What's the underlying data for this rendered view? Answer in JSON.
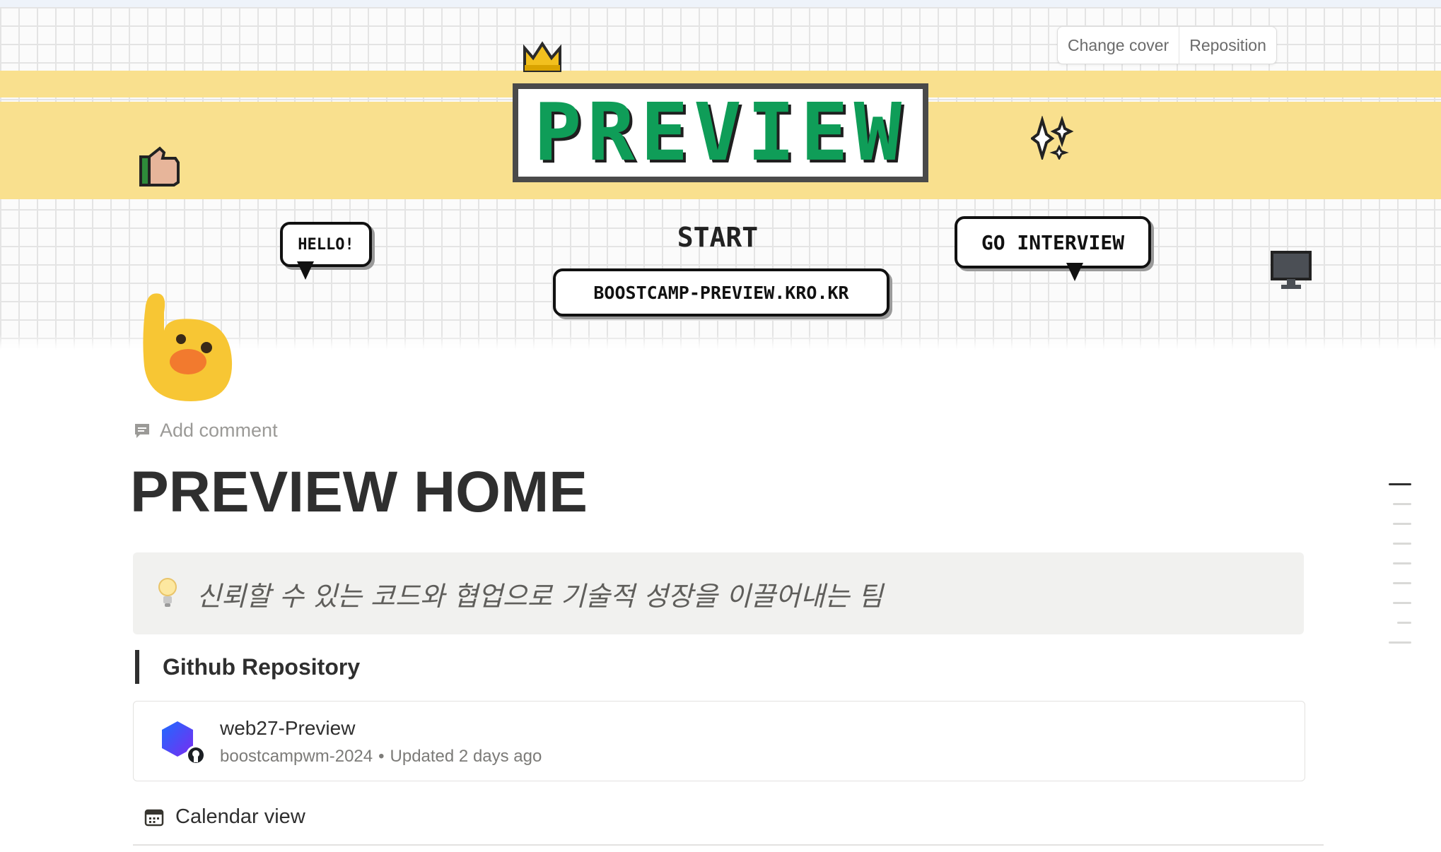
{
  "cover": {
    "logo_text": "PREVIEW",
    "start_label": "START",
    "hello_bubble": "HELLO!",
    "interview_bubble": "GO INTERVIEW",
    "url_badge": "BOOSTCAMP-PREVIEW.KRO.KR",
    "change_cover": "Change cover",
    "reposition": "Reposition",
    "band_color": "#f9e08e",
    "logo_color": "#0f9d58"
  },
  "page": {
    "icon": "waving-hand-blob-icon",
    "add_comment": "Add comment",
    "title": "PREVIEW HOME"
  },
  "callout": {
    "icon": "lightbulb-icon",
    "text": "신뢰할 수 있는 코드와 협업으로 기술적 성장을 이끌어내는 팀"
  },
  "section": {
    "heading": "Github Repository"
  },
  "github_card": {
    "repo_name": "web27-Preview",
    "owner": "boostcampwm-2024",
    "separator": "•",
    "updated": "Updated 2 days ago"
  },
  "calendar": {
    "label": "Calendar view"
  }
}
